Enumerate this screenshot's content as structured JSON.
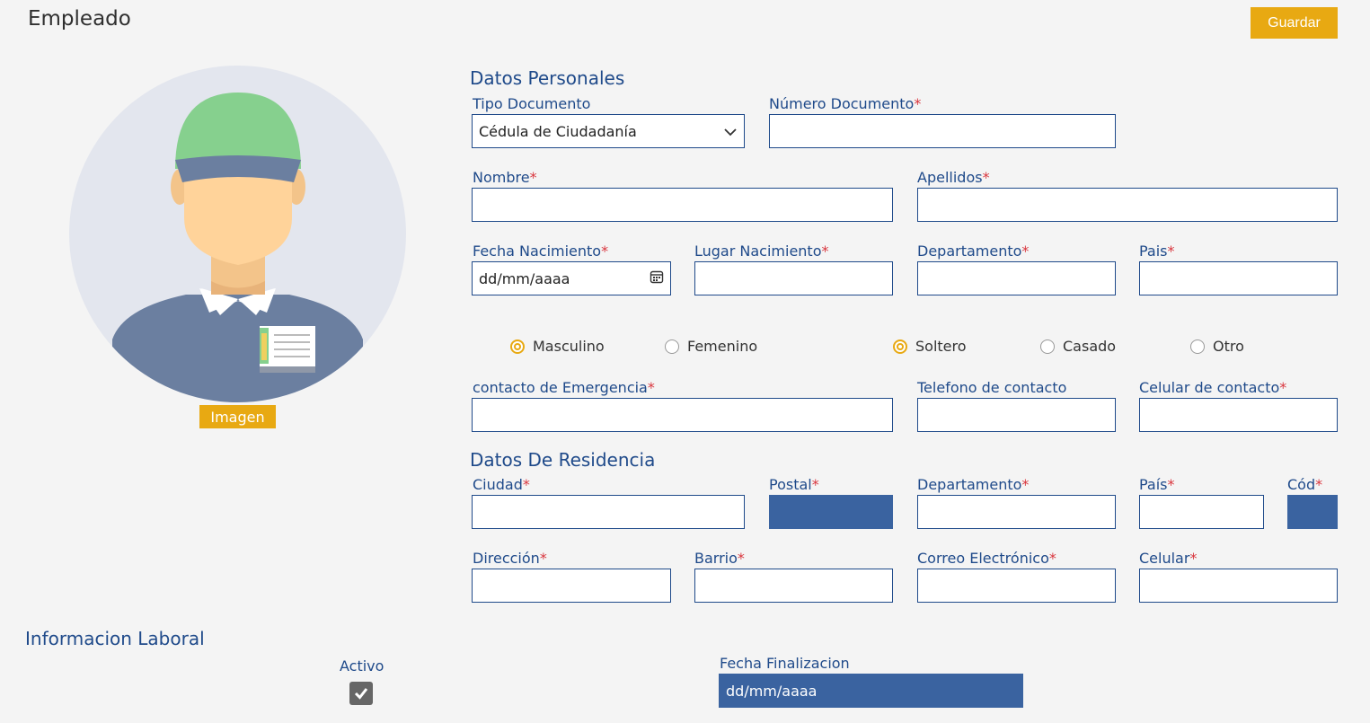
{
  "header": {
    "title": "Empleado",
    "save_label": "Guardar"
  },
  "avatar": {
    "image_button": "Imagen"
  },
  "personal": {
    "title": "Datos Personales",
    "tipo_documento": {
      "label": "Tipo Documento",
      "value": "Cédula de Ciudadanía"
    },
    "numero_documento": {
      "label": "Número Documento",
      "required": "*"
    },
    "nombre": {
      "label": "Nombre",
      "required": "*"
    },
    "apellidos": {
      "label": "Apellidos",
      "required": "*"
    },
    "fecha_nacimiento": {
      "label": "Fecha Nacimiento",
      "required": "*",
      "value": "dd/mm/aaaa"
    },
    "lugar_nacimiento": {
      "label": "Lugar Nacimiento",
      "required": "*"
    },
    "departamento": {
      "label": "Departamento",
      "required": "*"
    },
    "pais": {
      "label": "Pais",
      "required": "*"
    },
    "sexo": {
      "masculino": "Masculino",
      "femenino": "Femenino",
      "selected": "Masculino"
    },
    "estado_civil": {
      "soltero": "Soltero",
      "casado": "Casado",
      "otro": "Otro",
      "selected": "Soltero"
    },
    "contacto_emergencia": {
      "label": "contacto de Emergencia",
      "required": "*"
    },
    "telefono_contacto": {
      "label": "Telefono de contacto"
    },
    "celular_contacto": {
      "label": "Celular de contacto",
      "required": "*"
    }
  },
  "residencia": {
    "title": "Datos De Residencia",
    "ciudad": {
      "label": "Ciudad",
      "required": "*"
    },
    "postal": {
      "label": "Postal",
      "required": "*"
    },
    "departamento": {
      "label": "Departamento",
      "required": "*"
    },
    "pais": {
      "label": "País",
      "required": "*"
    },
    "cod": {
      "label": "Cód",
      "required": "*"
    },
    "direccion": {
      "label": "Dirección",
      "required": "*"
    },
    "barrio": {
      "label": "Barrio",
      "required": "*"
    },
    "correo": {
      "label": "Correo Electrónico",
      "required": "*"
    },
    "celular": {
      "label": "Celular",
      "required": "*"
    }
  },
  "laboral": {
    "title": "Informacion Laboral",
    "activo_label": "Activo",
    "activo_checked": true,
    "fecha_finalizacion": {
      "label": "Fecha Finalizacion",
      "value": "dd/mm/aaaa"
    }
  },
  "colors": {
    "accent": "#e8a912",
    "primary": "#1f4a8a",
    "filled": "#3a63a0"
  }
}
